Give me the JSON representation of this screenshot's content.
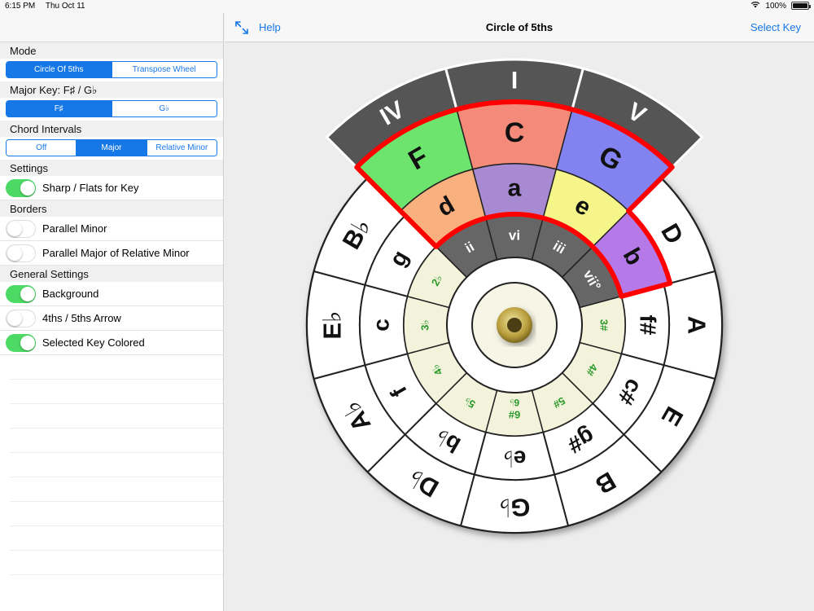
{
  "status": {
    "time": "6:15 PM",
    "date": "Thu Oct 11",
    "battery": "100%",
    "battery_fraction": 1.0
  },
  "nav": {
    "help": "Help",
    "title": "Circle of 5ths",
    "select_key": "Select Key"
  },
  "sidebar": {
    "mode": {
      "header": "Mode",
      "options": [
        "Circle Of 5ths",
        "Transpose Wheel"
      ],
      "selected": 0
    },
    "major_key": {
      "header": "Major Key: F♯ / G♭",
      "options": [
        "F♯",
        "G♭"
      ],
      "selected": 0
    },
    "chord_intervals": {
      "header": "Chord Intervals",
      "options": [
        "Off",
        "Major",
        "Relative Minor"
      ],
      "selected": 1
    },
    "settings": {
      "header": "Settings",
      "items": [
        {
          "label": "Sharp / Flats for Key",
          "on": true
        }
      ]
    },
    "borders": {
      "header": "Borders",
      "items": [
        {
          "label": "Parallel Minor",
          "on": false
        },
        {
          "label": "Parallel Major of Relative Minor",
          "on": false
        }
      ]
    },
    "general": {
      "header": "General Settings",
      "items": [
        {
          "label": "Background",
          "on": true
        },
        {
          "label": "4ths / 5ths Arrow",
          "on": false
        },
        {
          "label": "Selected Key Colored",
          "on": true
        }
      ]
    }
  },
  "wheel": {
    "major": [
      "C",
      "G",
      "D",
      "A",
      "E",
      "B",
      "G♭",
      "D♭",
      "A♭",
      "E♭",
      "B♭",
      "F"
    ],
    "minor": [
      "a",
      "e",
      "b",
      "f#",
      "c#",
      "g#",
      "e♭",
      "b♭",
      "f",
      "c",
      "g",
      "d"
    ],
    "intervals": [
      "vi",
      "iii",
      "vii°",
      "3#",
      "4#",
      "5#",
      "6#",
      "5♭",
      "4♭",
      "3♭",
      "2♭",
      "ii"
    ],
    "intervals_alt": {
      "6#": "6♭"
    },
    "degrees": [
      "IV",
      "I",
      "V"
    ],
    "highlight_colors": {
      "F": "#6de46d",
      "C": "#f48a7a",
      "G": "#8282f0",
      "d": "#f7b07e",
      "a": "#a88ad2",
      "e": "#f5f58a",
      "b": "#b57ae8"
    },
    "degree_color": "#555555",
    "border_color": "#ff0000",
    "interval_dark": "#666666",
    "interval_light": "#f3f3dc",
    "interval_text": "#2a9a2a"
  }
}
